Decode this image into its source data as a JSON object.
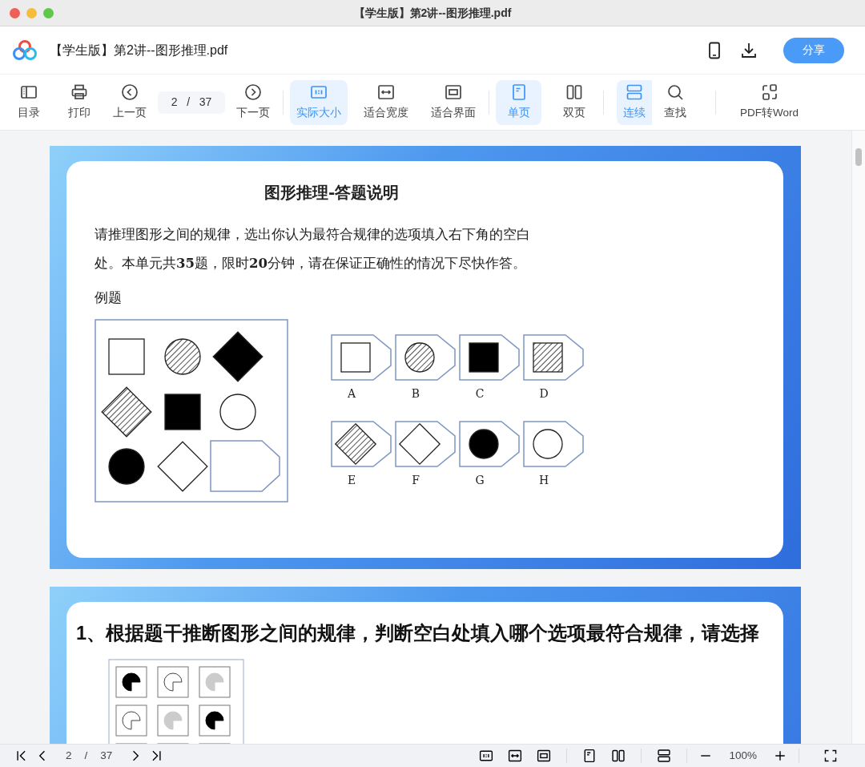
{
  "window": {
    "title": "【学生版】第2讲--图形推理.pdf"
  },
  "header": {
    "filename": "【学生版】第2讲--图形推理.pdf",
    "share_button": "分享"
  },
  "toolbar": {
    "groups": [
      [
        {
          "kind": "button",
          "label": "目录",
          "selected": false
        },
        {
          "kind": "button",
          "label": "打印",
          "selected": false
        },
        {
          "kind": "button",
          "label": "上一页",
          "selected": false
        },
        {
          "kind": "pager",
          "current": "2",
          "separator": "/",
          "total": "37"
        },
        {
          "kind": "button",
          "label": "下一页",
          "selected": false
        }
      ],
      [
        {
          "kind": "button",
          "label": "实际大小",
          "selected": true
        },
        {
          "kind": "button",
          "label": "适合宽度",
          "selected": false
        },
        {
          "kind": "button",
          "label": "适合界面",
          "selected": false
        }
      ],
      [
        {
          "kind": "button",
          "label": "单页",
          "selected": true
        },
        {
          "kind": "button",
          "label": "双页",
          "selected": false
        }
      ],
      [
        {
          "kind": "button",
          "label": "连续",
          "selected": true
        },
        {
          "kind": "button",
          "label": "查找",
          "selected": false
        }
      ],
      [
        {
          "kind": "button",
          "label": "PDF转Word",
          "selected": false
        }
      ]
    ]
  },
  "pages": [
    {
      "kind": "instructions",
      "title": "图形推理-答题说明",
      "lines": [
        "请推理图形之间的规律，选出你认为最符合规律的选项填入右下角的空白",
        "处。本单元共**35**题，限时**20**分钟，请在保证正确性的情况下尽快作答。"
      ],
      "example_label": "例题",
      "cells": [
        {
          "kind": "square",
          "filled": false,
          "hatched": false
        },
        {
          "kind": "circle",
          "filled": false,
          "hatched": true
        },
        {
          "kind": "diamond",
          "filled": true,
          "hatched": false
        },
        {
          "kind": "diamond",
          "filled": false,
          "hatched": true
        },
        {
          "kind": "square",
          "filled": true,
          "hatched": false
        },
        {
          "kind": "circle",
          "filled": false,
          "hatched": false
        },
        {
          "kind": "circle",
          "filled": true,
          "hatched": false
        },
        {
          "kind": "diamond",
          "filled": false,
          "hatched": false
        },
        {
          "kind": "blank"
        }
      ],
      "options": [
        {
          "label": "A",
          "kind": "square",
          "filled": false,
          "hatched": false
        },
        {
          "label": "B",
          "kind": "circle",
          "filled": false,
          "hatched": true
        },
        {
          "label": "C",
          "kind": "square",
          "filled": true,
          "hatched": false
        },
        {
          "label": "D",
          "kind": "square",
          "filled": false,
          "hatched": true
        },
        {
          "label": "E",
          "kind": "diamond",
          "filled": false,
          "hatched": true
        },
        {
          "label": "F",
          "kind": "diamond",
          "filled": false,
          "hatched": false
        },
        {
          "label": "G",
          "kind": "circle",
          "filled": true,
          "hatched": false
        },
        {
          "label": "H",
          "kind": "circle",
          "filled": false,
          "hatched": false
        }
      ]
    },
    {
      "kind": "question",
      "heading": "1、根据题干推断图形之间的规律，判断空白处填入哪个选项最符合规律，请选择"
    }
  ],
  "status_bar": {
    "current": "2",
    "separator": "/",
    "total": "37",
    "zoom": "100%"
  }
}
